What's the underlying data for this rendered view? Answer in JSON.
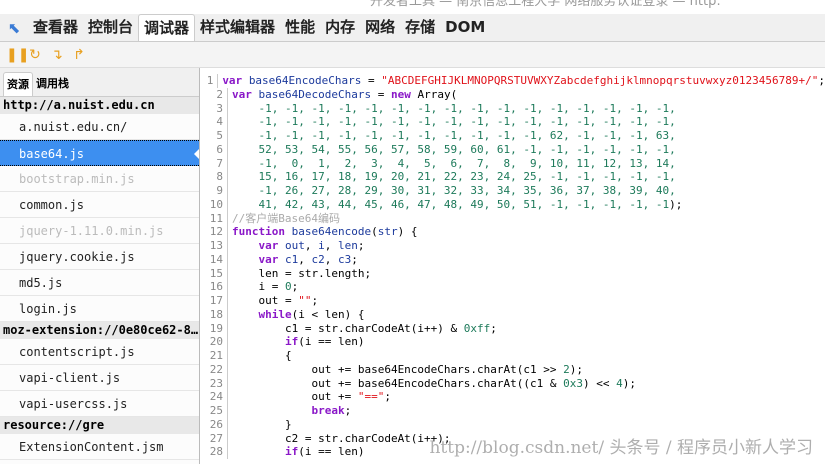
{
  "window_title": "开发者工具 — 南京信息工程大学 网络服务认证登录 — http:",
  "toolbar_tabs": [
    "查看器",
    "控制台",
    "调试器",
    "样式编辑器",
    "性能",
    "内存",
    "网络",
    "存储",
    "DOM"
  ],
  "selected_tab": 2,
  "debugger_buttons": [
    "pause",
    "step-over",
    "step-in",
    "step-out"
  ],
  "sidebar": {
    "tabs": [
      "资源",
      "调用栈"
    ],
    "groups": [
      {
        "name": "http://a.nuist.edu.cn",
        "items": [
          "a.nuist.edu.cn/",
          "base64.js",
          "bootstrap.min.js",
          "common.js",
          "jquery-1.11.0.min.js",
          "jquery.cookie.js",
          "md5.js",
          "login.js"
        ]
      },
      {
        "name": "moz-extension://0e80ce62-8…",
        "items": [
          "contentscript.js",
          "vapi-client.js",
          "vapi-usercss.js"
        ]
      },
      {
        "name": "resource://gre",
        "items": [
          "ExtensionContent.jsm"
        ]
      }
    ],
    "selected": "base64.js",
    "dimmed": [
      "bootstrap.min.js",
      "jquery-1.11.0.min.js"
    ]
  },
  "code": [
    [
      [
        "k",
        "var "
      ],
      [
        "v",
        "base64EncodeChars"
      ],
      [
        "p",
        " = "
      ],
      [
        "s",
        "\"ABCDEFGHIJKLMNOPQRSTUVWXYZabcdefghijklmnopqrstuvwxyz0123456789+/\""
      ],
      [
        "p",
        ";"
      ]
    ],
    [
      [
        "k",
        "var "
      ],
      [
        "v",
        "base64DecodeChars"
      ],
      [
        "p",
        " = "
      ],
      [
        "k",
        "new "
      ],
      [
        "p",
        "Array("
      ]
    ],
    [
      [
        "n",
        "    -1, -1, -1, -1, -1, -1, -1, -1, -1, -1, -1, -1, -1, -1, -1, -1,"
      ]
    ],
    [
      [
        "n",
        "    -1, -1, -1, -1, -1, -1, -1, -1, -1, -1, -1, -1, -1, -1, -1, -1,"
      ]
    ],
    [
      [
        "n",
        "    -1, -1, -1, -1, -1, -1, -1, -1, -1, -1, -1, 62, -1, -1, -1, 63,"
      ]
    ],
    [
      [
        "n",
        "    52, 53, 54, 55, 56, 57, 58, 59, 60, 61, -1, -1, -1, -1, -1, -1,"
      ]
    ],
    [
      [
        "n",
        "    -1,  0,  1,  2,  3,  4,  5,  6,  7,  8,  9, 10, 11, 12, 13, 14,"
      ]
    ],
    [
      [
        "n",
        "    15, 16, 17, 18, 19, 20, 21, 22, 23, 24, 25, -1, -1, -1, -1, -1,"
      ]
    ],
    [
      [
        "n",
        "    -1, 26, 27, 28, 29, 30, 31, 32, 33, 34, 35, 36, 37, 38, 39, 40,"
      ]
    ],
    [
      [
        "n",
        "    41, 42, 43, 44, 45, 46, 47, 48, 49, 50, 51, -1, -1, -1, -1, -1"
      ],
      [
        "p",
        ");"
      ]
    ],
    [
      [
        "c",
        "//客户端Base64编码"
      ]
    ],
    [
      [
        "k",
        "function "
      ],
      [
        "v",
        "base64encode"
      ],
      [
        "p",
        "("
      ],
      [
        "v",
        "str"
      ],
      [
        "p",
        ") {"
      ]
    ],
    [
      [
        "p",
        "    "
      ],
      [
        "k",
        "var "
      ],
      [
        "v",
        "out"
      ],
      [
        "p",
        ", "
      ],
      [
        "v",
        "i"
      ],
      [
        "p",
        ", "
      ],
      [
        "v",
        "len"
      ],
      [
        "p",
        ";"
      ]
    ],
    [
      [
        "p",
        "    "
      ],
      [
        "k",
        "var "
      ],
      [
        "v",
        "c1"
      ],
      [
        "p",
        ", "
      ],
      [
        "v",
        "c2"
      ],
      [
        "p",
        ", "
      ],
      [
        "v",
        "c3"
      ],
      [
        "p",
        ";"
      ]
    ],
    [
      [
        "p",
        "    len = str.length;"
      ]
    ],
    [
      [
        "p",
        "    i = "
      ],
      [
        "n",
        "0"
      ],
      [
        "p",
        ";"
      ]
    ],
    [
      [
        "p",
        "    out = "
      ],
      [
        "s",
        "\"\""
      ],
      [
        "p",
        ";"
      ]
    ],
    [
      [
        "p",
        "    "
      ],
      [
        "k",
        "while"
      ],
      [
        "p",
        "(i < len) {"
      ]
    ],
    [
      [
        "p",
        "        c1 = str.charCodeAt(i++) & "
      ],
      [
        "n",
        "0xff"
      ],
      [
        "p",
        ";"
      ]
    ],
    [
      [
        "p",
        "        "
      ],
      [
        "k",
        "if"
      ],
      [
        "p",
        "(i == len)"
      ]
    ],
    [
      [
        "p",
        "        {"
      ]
    ],
    [
      [
        "p",
        "            out += base64EncodeChars.charAt(c1 >> "
      ],
      [
        "n",
        "2"
      ],
      [
        "p",
        ");"
      ]
    ],
    [
      [
        "p",
        "            out += base64EncodeChars.charAt((c1 & "
      ],
      [
        "n",
        "0x3"
      ],
      [
        "p",
        ") << "
      ],
      [
        "n",
        "4"
      ],
      [
        "p",
        ");"
      ]
    ],
    [
      [
        "p",
        "            out += "
      ],
      [
        "s",
        "\"==\""
      ],
      [
        "p",
        ";"
      ]
    ],
    [
      [
        "p",
        "            "
      ],
      [
        "k",
        "break"
      ],
      [
        "p",
        ";"
      ]
    ],
    [
      [
        "p",
        "        }"
      ]
    ],
    [
      [
        "p",
        "        c2 = str.charCodeAt(i++);"
      ]
    ],
    [
      [
        "p",
        "        "
      ],
      [
        "k",
        "if"
      ],
      [
        "p",
        "(i == len)"
      ]
    ]
  ],
  "watermark": "http://blog.csdn.net/ 头条号 / 程序员小新人学习"
}
